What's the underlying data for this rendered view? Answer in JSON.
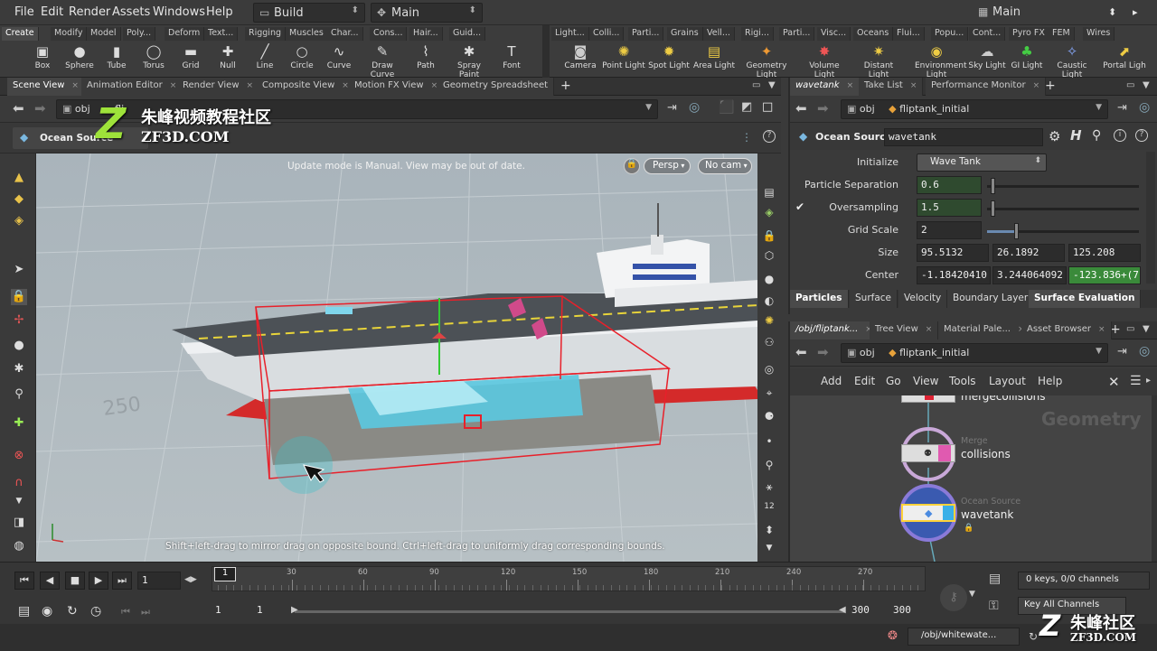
{
  "menu": {
    "items": [
      "File",
      "Edit",
      "Render",
      "Assets",
      "Windows",
      "Help"
    ],
    "desktop": "Build",
    "context": "Main",
    "right_desktop": "Main"
  },
  "shelf_left": {
    "tabs": [
      "Create",
      "Modify",
      "Model",
      "Poly...",
      "Deform",
      "Text...",
      "Rigging",
      "Muscles",
      "Char...",
      "Cons...",
      "Hair...",
      "Guid..."
    ],
    "tools": [
      {
        "label": "Box",
        "icon": "box-icon",
        "glyph": "▣"
      },
      {
        "label": "Sphere",
        "icon": "sphere-icon",
        "glyph": "●"
      },
      {
        "label": "Tube",
        "icon": "tube-icon",
        "glyph": "▮"
      },
      {
        "label": "Torus",
        "icon": "torus-icon",
        "glyph": "◯"
      },
      {
        "label": "Grid",
        "icon": "grid-icon",
        "glyph": "▬"
      },
      {
        "label": "Null",
        "icon": "null-icon",
        "glyph": "✚"
      },
      {
        "label": "Line",
        "icon": "line-icon",
        "glyph": "╱"
      },
      {
        "label": "Circle",
        "icon": "circle-icon",
        "glyph": "○"
      },
      {
        "label": "Curve",
        "icon": "curve-icon",
        "glyph": "∿"
      },
      {
        "label": "Draw Curve",
        "icon": "draw-curve-icon",
        "glyph": "✎"
      },
      {
        "label": "Path",
        "icon": "path-icon",
        "glyph": "⌇"
      },
      {
        "label": "Spray Paint",
        "icon": "spray-paint-icon",
        "glyph": "✱"
      },
      {
        "label": "Font",
        "icon": "font-icon",
        "glyph": "T"
      }
    ]
  },
  "shelf_right": {
    "tabs": [
      "Light...",
      "Colli...",
      "Parti...",
      "Grains",
      "Vell...",
      "Rigi...",
      "Parti...",
      "Visc...",
      "Oceans",
      "Flui...",
      "Popu...",
      "Cont...",
      "Pyro FX",
      "FEM",
      "Wires"
    ],
    "tools": [
      {
        "label": "Camera",
        "icon": "camera-icon",
        "glyph": "◙"
      },
      {
        "label": "Point Light",
        "icon": "point-light-icon",
        "glyph": "✺"
      },
      {
        "label": "Spot Light",
        "icon": "spot-light-icon",
        "glyph": "✹"
      },
      {
        "label": "Area Light",
        "icon": "area-light-icon",
        "glyph": "▤"
      },
      {
        "label": "Geometry Light",
        "icon": "geometry-light-icon",
        "glyph": "✦"
      },
      {
        "label": "Volume Light",
        "icon": "volume-light-icon",
        "glyph": "✸"
      },
      {
        "label": "Distant Light",
        "icon": "distant-light-icon",
        "glyph": "✷"
      },
      {
        "label": "Environment Light",
        "icon": "environment-light-icon",
        "glyph": "◉"
      },
      {
        "label": "Sky Light",
        "icon": "sky-light-icon",
        "glyph": "☁"
      },
      {
        "label": "GI Light",
        "icon": "gi-light-icon",
        "glyph": "♣"
      },
      {
        "label": "Caustic Light",
        "icon": "caustic-light-icon",
        "glyph": "✧"
      },
      {
        "label": "Portal Ligh",
        "icon": "portal-light-icon",
        "glyph": "⬈"
      }
    ]
  },
  "left_pane": {
    "tabs": [
      "Scene View",
      "Animation Editor",
      "Render View",
      "Composite View",
      "Motion FX View",
      "Geometry Spreadsheet"
    ],
    "path": "obj",
    "path_node": "fli",
    "tool_name": "Ocean Source",
    "viewport_message": "Update mode is Manual. View may be out of date.",
    "persp_label": "Persp",
    "cam_label": "No cam",
    "hint": "Shift+left-drag to mirror drag on opposite bound. Ctrl+left-drag to uniformly drag corresponding bounds.",
    "ground_number": "250"
  },
  "watermark": {
    "logo_letter": "Z",
    "title": "朱峰视频教程社区",
    "url": "ZF3D.COM",
    "corner_title": "朱峰社区",
    "corner_url": "ZF3D.COM"
  },
  "parm_pane": {
    "tabs": [
      "wavetank",
      "Take List",
      "Performance Monitor"
    ],
    "path": "obj",
    "node_path": "fliptank_initial",
    "node_type": "Ocean Source",
    "node_name": "wavetank",
    "rows": [
      {
        "label": "Initialize",
        "value": "Wave Tank"
      },
      {
        "label": "Particle Separation",
        "value": "0.6"
      },
      {
        "label": "Oversampling",
        "value": "1.5"
      },
      {
        "label": "Grid Scale",
        "value": "2"
      },
      {
        "label": "Size",
        "values": [
          "95.5132",
          "26.1892",
          "125.208"
        ]
      },
      {
        "label": "Center",
        "values": [
          "-1.18420410",
          "3.244064092",
          "-123.836+(7"
        ]
      }
    ],
    "check": "✔",
    "subtabs": [
      "Particles",
      "Surface",
      "Velocity",
      "Boundary Layer",
      "Surface Evaluation"
    ]
  },
  "network_pane": {
    "tabs": [
      "/obj/fliptank...",
      "Tree View",
      "Material Pale...",
      "Asset Browser"
    ],
    "path": "obj",
    "node_path": "fliptank_initial",
    "menus": [
      "Add",
      "Edit",
      "Go",
      "View",
      "Tools",
      "Layout",
      "Help"
    ],
    "context_label": "Geometry",
    "nodes": [
      {
        "type": "",
        "name": "mergecollisions"
      },
      {
        "type": "Merge",
        "name": "collisions"
      },
      {
        "type": "Ocean Source",
        "name": "wavetank"
      }
    ]
  },
  "timeline": {
    "frame": "1",
    "playhead": "1",
    "ticks": [
      "30",
      "60",
      "90",
      "120",
      "150",
      "180",
      "210",
      "240",
      "270"
    ],
    "start": "1",
    "start2": "1",
    "end": "300",
    "end2": "300",
    "keys_status": "0 keys, 0/0 channels",
    "key_all": "Key All Channels",
    "status_path": "/obj/whitewate..."
  }
}
